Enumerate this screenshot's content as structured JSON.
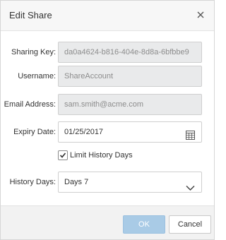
{
  "dialog": {
    "title": "Edit Share",
    "close_icon": "close-icon"
  },
  "form": {
    "sharing_key": {
      "label": "Sharing Key:",
      "value": "da0a4624-b816-404e-8d8a-6bfbbe9"
    },
    "username": {
      "label": "Username:",
      "value": "ShareAccount"
    },
    "email": {
      "label": "Email Address:",
      "value": "sam.smith@acme.com"
    },
    "expiry_date": {
      "label": "Expiry Date:",
      "value": "01/25/2017",
      "icon": "calendar-icon"
    },
    "limit_history": {
      "label": "Limit History Days",
      "checked": true
    },
    "history_days": {
      "label": "History Days:",
      "value": "Days 7",
      "icon": "chevron-down-icon"
    }
  },
  "footer": {
    "ok_label": "OK",
    "cancel_label": "Cancel"
  },
  "colors": {
    "ok_button": "#a9cbe6",
    "readonly_field": "#e9eaeb",
    "header_bg": "#f7f7f7"
  }
}
